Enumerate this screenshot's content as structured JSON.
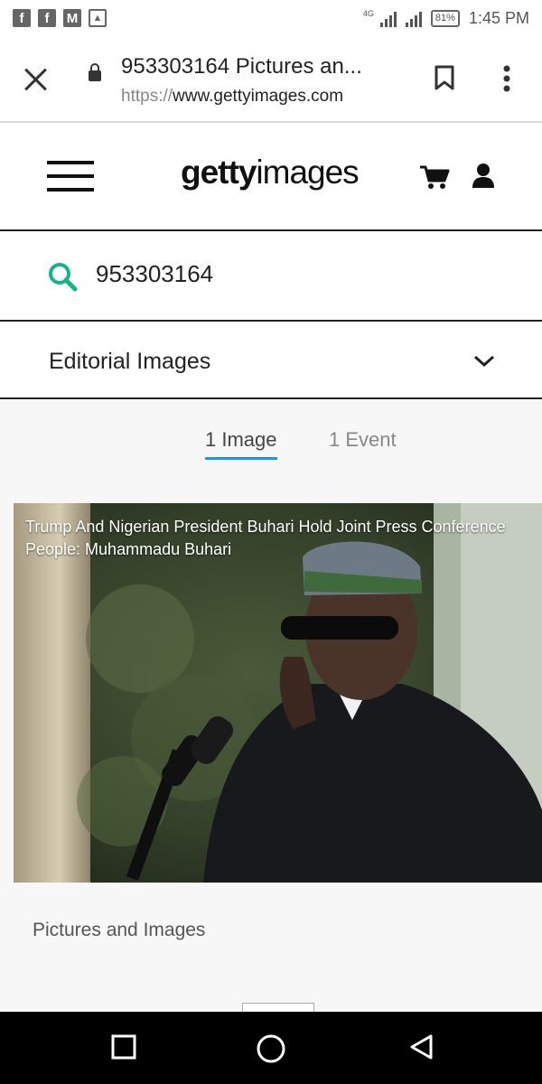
{
  "status_bar": {
    "time": "1:45 PM",
    "battery": "81%",
    "network": "4G",
    "icons": [
      "facebook-icon",
      "facebook-icon",
      "gmail-icon",
      "gallery-icon"
    ]
  },
  "browser": {
    "page_title": "953303164 Pictures an...",
    "url_scheme": "https://",
    "url_host": "www.gettyimages.com",
    "icons": [
      "close-icon",
      "lock-icon",
      "bookmark-icon",
      "more-vertical-icon"
    ]
  },
  "site_header": {
    "logo_bold": "getty",
    "logo_light": "images",
    "icons": [
      "menu-icon",
      "cart-icon",
      "user-icon"
    ]
  },
  "search": {
    "query": "953303164",
    "icon": "search-icon"
  },
  "filter": {
    "selected": "Editorial Images",
    "icon": "chevron-down-icon"
  },
  "tabs": [
    {
      "label": "1 Image",
      "active": true
    },
    {
      "label": "1 Event",
      "active": false
    }
  ],
  "result": {
    "title": "Trump And Nigerian President Buhari Hold Joint Press Conference",
    "people": "People: Muhammadu Buhari"
  },
  "section_label": "Pictures and Images",
  "colors": {
    "accent_search": "#18b38c",
    "tab_underline": "#1a9cd8"
  }
}
